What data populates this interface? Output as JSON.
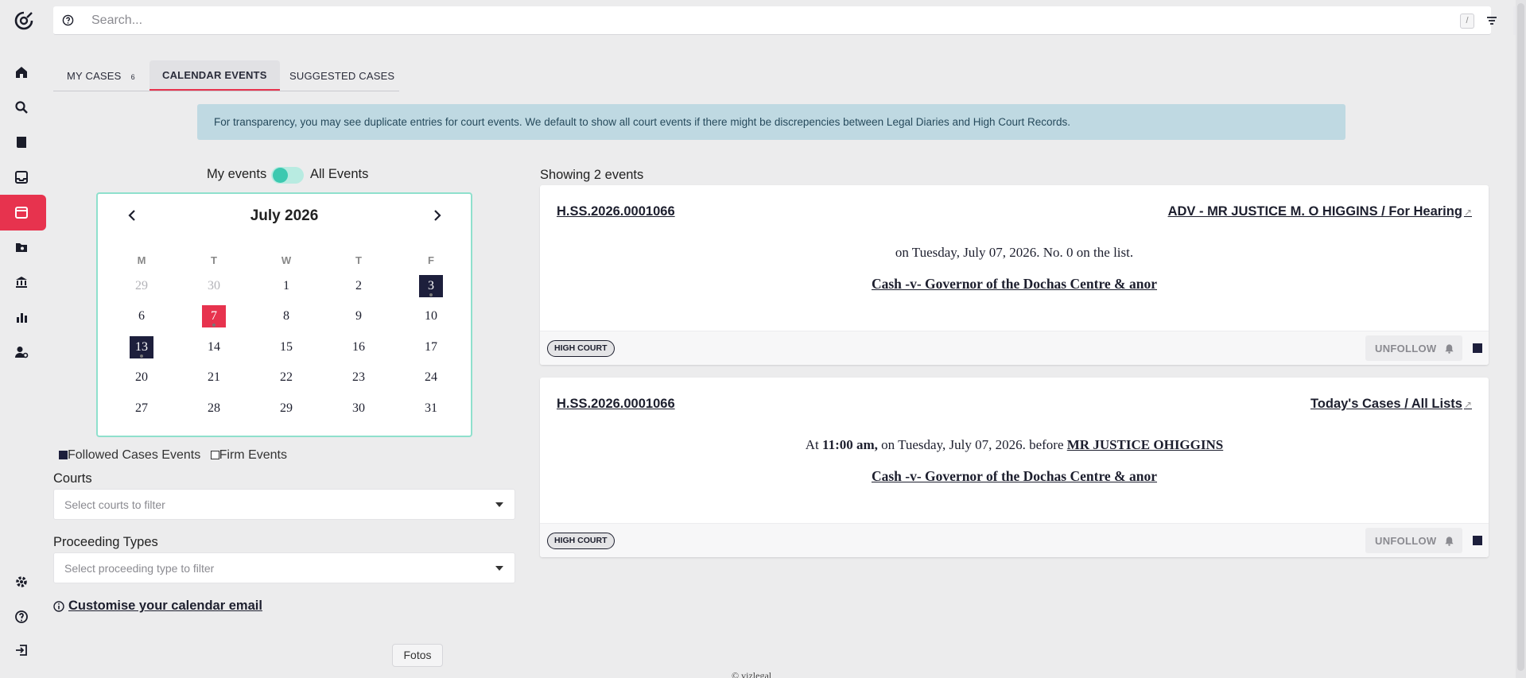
{
  "search": {
    "placeholder": "Search...",
    "shortcut": "/"
  },
  "tabs": [
    {
      "label": "MY CASES",
      "count": "6"
    },
    {
      "label": "CALENDAR EVENTS"
    },
    {
      "label": "SUGGESTED CASES"
    }
  ],
  "banner": "For transparency, you may see duplicate entries for court events. We default to show all court events if there might be discrepencies between Legal Diaries and High Court Records.",
  "toggle": {
    "left_label": "My events",
    "right_label": "All Events",
    "state": "All Events"
  },
  "calendar": {
    "month": "July 2026",
    "weekdays": [
      "M",
      "T",
      "W",
      "T",
      "F"
    ],
    "weeks": [
      [
        "29",
        "30",
        "1",
        "2",
        "3"
      ],
      [
        "6",
        "7",
        "8",
        "9",
        "10"
      ],
      [
        "13",
        "14",
        "15",
        "16",
        "17"
      ],
      [
        "20",
        "21",
        "22",
        "23",
        "24"
      ],
      [
        "27",
        "28",
        "29",
        "30",
        "31"
      ]
    ]
  },
  "legend": {
    "followed": "Followed Cases Events",
    "firm": "Firm Events"
  },
  "filters": {
    "courts_label": "Courts",
    "courts_placeholder": "Select courts to filter",
    "proceeding_label": "Proceeding Types",
    "proceeding_placeholder": "Select proceeding type to filter"
  },
  "customise": "Customise your calendar email",
  "showing": "Showing 2 events",
  "events": [
    {
      "case_id": "H.SS.2026.0001066",
      "link": "ADV - MR JUSTICE M. O HIGGINS / For Hearing",
      "line": "on Tuesday, July 07, 2026. No. 0 on the list.",
      "title": "Cash -v- Governor of the Dochas Centre & anor",
      "badge": "HIGH COURT",
      "unfollow": "UNFOLLOW"
    },
    {
      "case_id": "H.SS.2026.0001066",
      "link": "Today's Cases / All Lists",
      "line_prefix": "At",
      "line_time": "11:00 am,",
      "line_mid": "on Tuesday, July 07, 2026. before",
      "line_judge": "MR JUSTICE OHIGGINS",
      "title": "Cash -v- Governor of the Dochas Centre & anor",
      "badge": "HIGH COURT",
      "unfollow": "UNFOLLOW"
    }
  ],
  "tooltip": "Fotos",
  "footer": "© vizlegal",
  "colors": {
    "accent": "#e7334e",
    "dark": "#1d1f3c",
    "teal": "#3cc9b0",
    "banner": "#bfd9e2"
  }
}
